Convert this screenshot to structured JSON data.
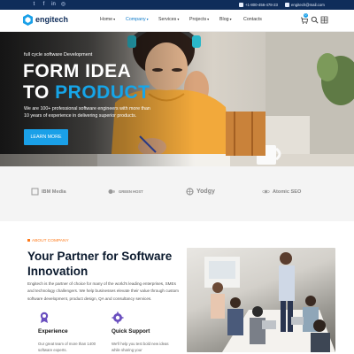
{
  "topbar": {
    "social": [
      "twitter-icon",
      "facebook-icon",
      "linkedin-icon",
      "instagram-icon"
    ],
    "phone": "+1-800-456-478-23",
    "email": "engitech@mail.com"
  },
  "nav": {
    "logo": "engitech",
    "items": [
      "Home",
      "Company",
      "Services",
      "Projects",
      "Blog",
      "Contacts"
    ],
    "active": "Company",
    "cart_count": "0"
  },
  "hero": {
    "kicker": "full cycle software Development",
    "title_line1": "FORM IDEA",
    "title_to": "TO",
    "title_accent": "PRODUCT",
    "description": "We are 100+ professional software engineers with more than 10 years of experience in delivering superior products.",
    "button": "LEARN MORE"
  },
  "brands": [
    "IBM Media",
    "GREEN HOST",
    "Yodgy",
    "Atomic SEO"
  ],
  "about": {
    "eyebrow": "ABOUT COMPANY",
    "title": "Your Partner for Software Innovation",
    "text": "Engitech is the partner of choice for many of the world's leading enterprises, SMEs and technology challengers. We help businesses elevate their value through custom software development, product design, QA and consultancy services.",
    "features": [
      {
        "title": "Experience",
        "text": "Our great team of more than 1400 software experts."
      },
      {
        "title": "Quick Support",
        "text": "We'll help you test bold new ideas while sharing your"
      }
    ]
  },
  "colors": {
    "navy": "#0f2d5a",
    "accent_blue": "#1aa0e8",
    "accent_orange": "#ff7a1a",
    "feature_purple": "#6a4fbf"
  }
}
